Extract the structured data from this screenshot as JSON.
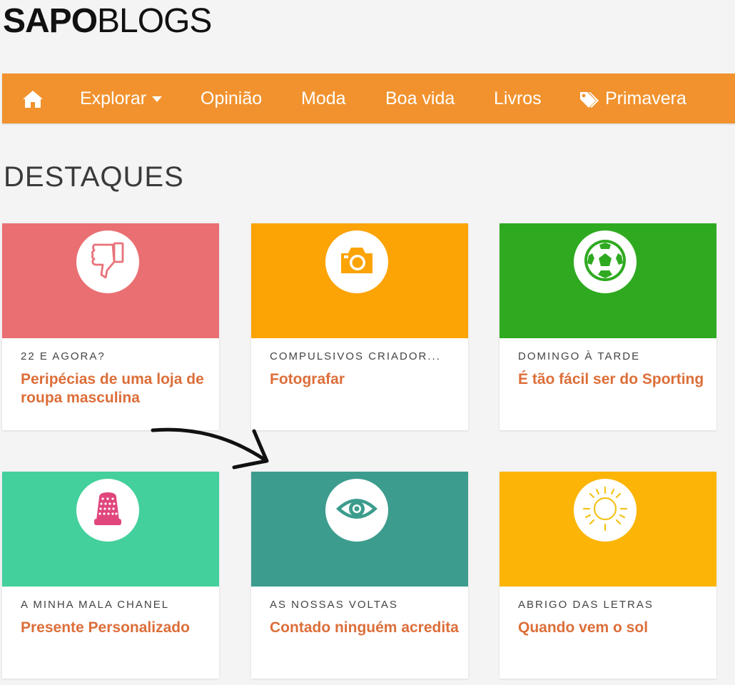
{
  "header": {
    "logo_bold": "SAPO",
    "logo_light": "BLOGS"
  },
  "nav": {
    "home_icon": "home-icon",
    "items": [
      {
        "label": "Explorar",
        "icon": "caret-down-icon"
      },
      {
        "label": "Opinião"
      },
      {
        "label": "Moda"
      },
      {
        "label": "Boa vida"
      },
      {
        "label": "Livros"
      },
      {
        "label": "Primavera",
        "icon": "tags-icon"
      }
    ]
  },
  "section": {
    "title": "DESTAQUES"
  },
  "cards": [
    {
      "blog": "22 E AGORA?",
      "title": "Peripécias de uma loja de roupa masculina",
      "color": "#ea6f72",
      "icon": "thumbs-down-icon"
    },
    {
      "blog": "COMPULSIVOS CRIADOR...",
      "title": "Fotografar",
      "color": "#fca306",
      "icon": "camera-icon"
    },
    {
      "blog": "DOMINGO À TARDE",
      "title": "É tão fácil ser do Sporting",
      "color": "#2faa20",
      "icon": "soccer-ball-icon"
    },
    {
      "blog": "A MINHA MALA CHANEL",
      "title": "Presente Personalizado",
      "color": "#43d09c",
      "icon": "thimble-icon"
    },
    {
      "blog": "AS NOSSAS VOLTAS",
      "title": "Contado ninguém acredita",
      "color": "#3c9c8d",
      "icon": "eye-icon"
    },
    {
      "blog": "ABRIGO DAS LETRAS",
      "title": "Quando vem o sol",
      "color": "#fcb506",
      "icon": "sun-icon"
    }
  ],
  "colors": {
    "nav_bg": "#f1922e",
    "title_accent": "#dc6e39",
    "page_bg": "#f4f4f5"
  }
}
